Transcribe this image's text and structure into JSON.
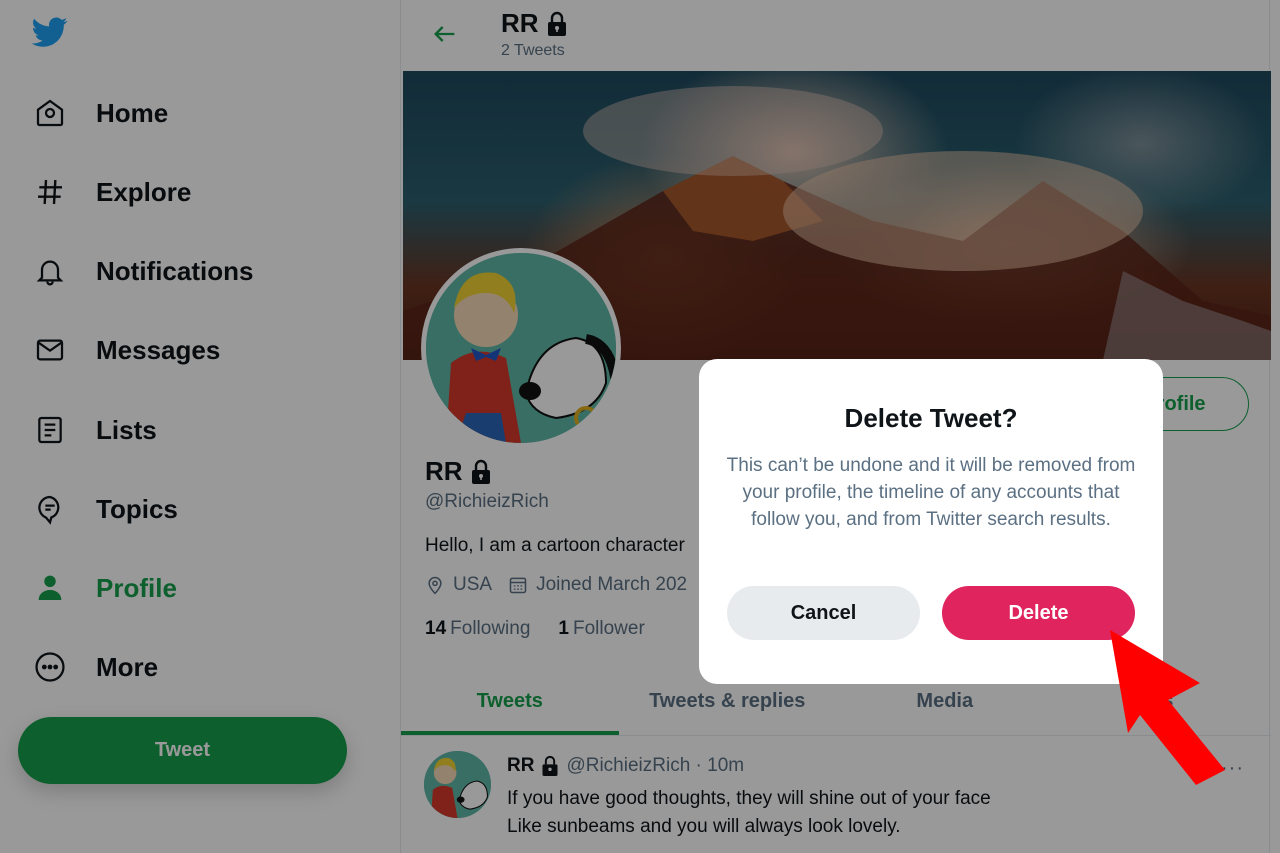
{
  "sidebar": {
    "logo": "twitter-bird",
    "items": [
      {
        "label": "Home",
        "icon": "home-icon",
        "active": false
      },
      {
        "label": "Explore",
        "icon": "hashtag-icon",
        "active": false
      },
      {
        "label": "Notifications",
        "icon": "bell-icon",
        "active": false
      },
      {
        "label": "Messages",
        "icon": "envelope-icon",
        "active": false
      },
      {
        "label": "Lists",
        "icon": "list-icon",
        "active": false
      },
      {
        "label": "Topics",
        "icon": "topics-icon",
        "active": false
      },
      {
        "label": "Profile",
        "icon": "user-icon",
        "active": true
      },
      {
        "label": "More",
        "icon": "more-circle-icon",
        "active": false
      }
    ],
    "tweet_button": "Tweet"
  },
  "header": {
    "name": "RR",
    "tweet_count": "2 Tweets"
  },
  "profile": {
    "name": "RR",
    "handle": "@RichieizRich",
    "bio": "Hello, I am a cartoon character",
    "location": "USA",
    "joined": "Joined March 202",
    "following_count": "14",
    "following_label": "Following",
    "followers_count": "1",
    "followers_label": "Follower",
    "edit_button": "profile"
  },
  "tabs": [
    {
      "label": "Tweets",
      "active": true
    },
    {
      "label": "Tweets & replies",
      "active": false
    },
    {
      "label": "Media",
      "active": false
    },
    {
      "label": "es",
      "active": false
    }
  ],
  "tweet": {
    "name": "RR",
    "meta": "@RichieizRich · 10m",
    "lines": [
      "If you have good thoughts, they will shine out of your face",
      "Like sunbeams and you will always look lovely."
    ],
    "more": "···"
  },
  "modal": {
    "title": "Delete Tweet?",
    "body": "This can’t be undone and it will be removed from your profile, the timeline of any accounts that follow you, and from Twitter search results.",
    "cancel": "Cancel",
    "delete": "Delete"
  },
  "colors": {
    "accent": "#17a04b",
    "danger": "#e0245e",
    "twitter_blue": "#1da1f2",
    "annotation_arrow": "#ff0000"
  }
}
